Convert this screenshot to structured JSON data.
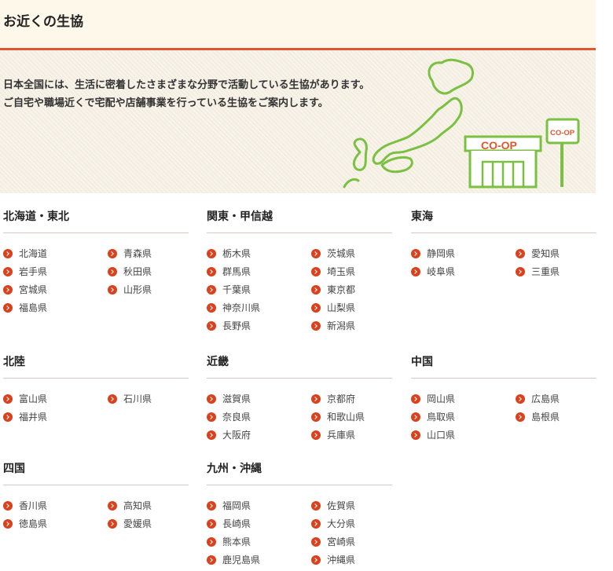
{
  "page": {
    "title": "お近くの生協",
    "intro": [
      "日本全国には、生活に密着したさまざまな分野で活動している生協があります。",
      "ご自宅や職場近くで宅配や店舗事業を行っている生協をご案内します。"
    ]
  },
  "banner": {
    "store_sign": "CO-OP",
    "pole_sign": "CO-OP"
  },
  "colors": {
    "accent_red": "#e2552d",
    "icon_red": "#d9421e",
    "art_green": "#7bc043",
    "header_bg": "#fdf8ea"
  },
  "regions": [
    {
      "name": "北海道・東北",
      "prefectures": [
        "北海道",
        "青森県",
        "岩手県",
        "秋田県",
        "宮城県",
        "山形県",
        "福島県"
      ]
    },
    {
      "name": "関東・甲信越",
      "prefectures": [
        "栃木県",
        "茨城県",
        "群馬県",
        "埼玉県",
        "千葉県",
        "東京都",
        "神奈川県",
        "山梨県",
        "長野県",
        "新潟県"
      ]
    },
    {
      "name": "東海",
      "prefectures": [
        "静岡県",
        "愛知県",
        "岐阜県",
        "三重県"
      ]
    },
    {
      "name": "北陸",
      "prefectures": [
        "富山県",
        "石川県",
        "福井県"
      ]
    },
    {
      "name": "近畿",
      "prefectures": [
        "滋賀県",
        "京都府",
        "奈良県",
        "和歌山県",
        "大阪府",
        "兵庫県"
      ]
    },
    {
      "name": "中国",
      "prefectures": [
        "岡山県",
        "広島県",
        "鳥取県",
        "島根県",
        "山口県"
      ]
    },
    {
      "name": "四国",
      "prefectures": [
        "香川県",
        "高知県",
        "徳島県",
        "愛媛県"
      ]
    },
    {
      "name": "九州・沖縄",
      "prefectures": [
        "福岡県",
        "佐賀県",
        "長崎県",
        "大分県",
        "熊本県",
        "宮崎県",
        "鹿児島県",
        "沖縄県"
      ]
    }
  ]
}
